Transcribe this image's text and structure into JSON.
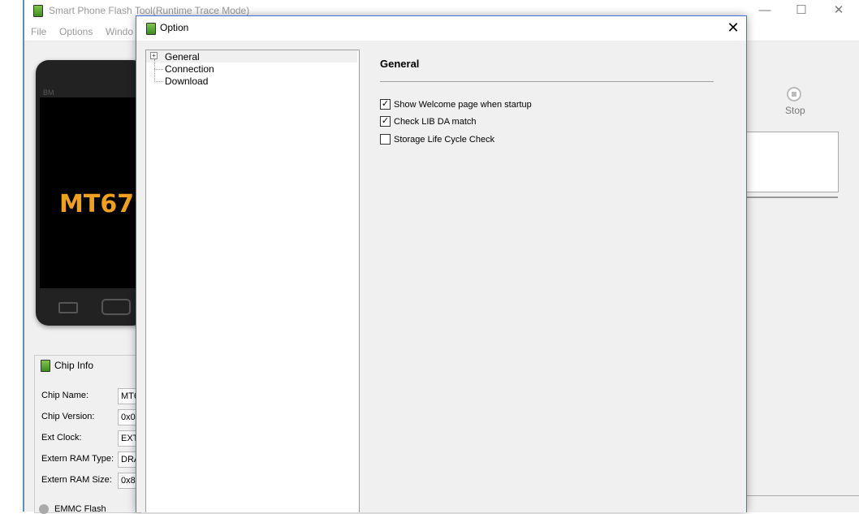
{
  "main_window": {
    "title": "Smart Phone Flash Tool(Runtime Trace Mode)",
    "menus": [
      "File",
      "Options",
      "Windo"
    ],
    "minimize_glyph": "—",
    "maximize_glyph": "☐",
    "close_glyph": "✕"
  },
  "phone": {
    "brand_label": "BM",
    "chip_text": "MT67"
  },
  "chip_info": {
    "title": "Chip Info",
    "rows": [
      {
        "label": "Chip Name:",
        "value": "MT6"
      },
      {
        "label": "Chip Version:",
        "value": "0x0"
      },
      {
        "label": "Ext Clock:",
        "value": "EXT"
      },
      {
        "label": "Extern RAM Type:",
        "value": "DRA"
      },
      {
        "label": "Extern RAM Size:",
        "value": "0x8"
      }
    ],
    "next_section": "EMMC Flash"
  },
  "toolbar": {
    "stop_label": "Stop"
  },
  "dialog": {
    "title": "Option",
    "close_glyph": "✕",
    "expander_glyph": "+",
    "tree": [
      "General",
      "Connection",
      "Download"
    ],
    "section_heading": "General",
    "options": [
      {
        "label": "Show Welcome page when startup",
        "checked": true
      },
      {
        "label": "Check LIB DA match",
        "checked": true
      },
      {
        "label": "Storage Life Cycle Check",
        "checked": false
      }
    ],
    "check_glyph": "✓"
  }
}
